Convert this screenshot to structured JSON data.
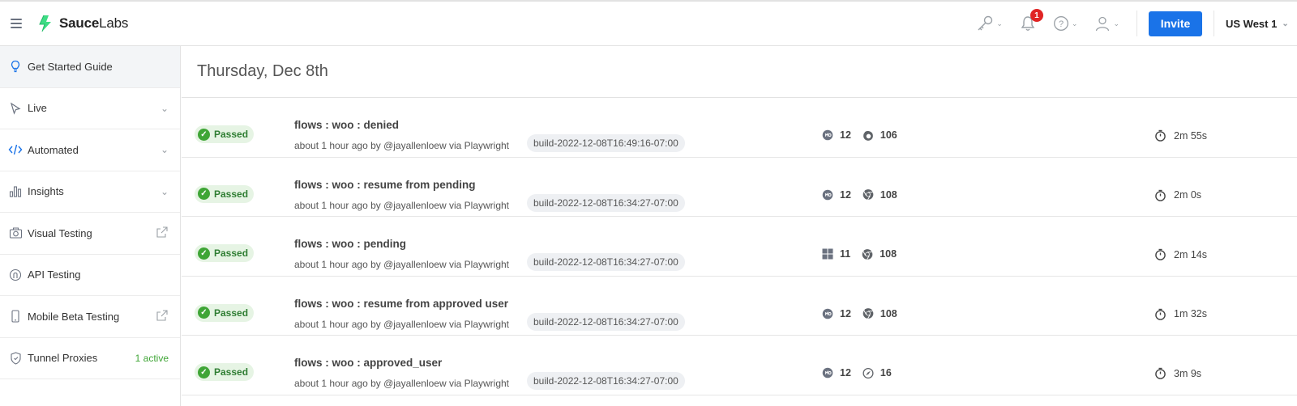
{
  "header": {
    "brand_bold": "Sauce",
    "brand_rest": "Labs",
    "notification_count": "1",
    "invite_label": "Invite",
    "region_label": "US West 1",
    "brand_color": "#3ddc84",
    "accent_color": "#1a73e8"
  },
  "sidebar": {
    "items": [
      {
        "label": "Get Started Guide",
        "icon": "lightbulb-icon",
        "right": ""
      },
      {
        "label": "Live",
        "icon": "cursor-icon",
        "right": "chevron-down"
      },
      {
        "label": "Automated",
        "icon": "code-icon",
        "right": "chevron-down"
      },
      {
        "label": "Insights",
        "icon": "bar-chart-icon",
        "right": "chevron-down"
      },
      {
        "label": "Visual Testing",
        "icon": "camera-icon",
        "right": "external-link"
      },
      {
        "label": "API Testing",
        "icon": "api-icon",
        "right": ""
      },
      {
        "label": "Mobile Beta Testing",
        "icon": "phone-icon",
        "right": "external-link"
      },
      {
        "label": "Tunnel Proxies",
        "icon": "shield-icon",
        "right": "1 active"
      }
    ]
  },
  "main": {
    "date_heading": "Thursday, Dec 8th",
    "rows": [
      {
        "status": "Passed",
        "title": "flows : woo : denied",
        "meta": "about 1 hour ago by @jayallenloew via Playwright",
        "build": "build-2022-12-08T16:49:16-07:00",
        "os_icon": "mac-icon",
        "os_version": "12",
        "browser_icon": "firefox-icon",
        "browser_version": "106",
        "duration": "2m 55s"
      },
      {
        "status": "Passed",
        "title": "flows : woo : resume from pending",
        "meta": "about 1 hour ago by @jayallenloew via Playwright",
        "build": "build-2022-12-08T16:34:27-07:00",
        "os_icon": "mac-icon",
        "os_version": "12",
        "browser_icon": "chrome-icon",
        "browser_version": "108",
        "duration": "2m 0s"
      },
      {
        "status": "Passed",
        "title": "flows : woo : pending",
        "meta": "about 1 hour ago by @jayallenloew via Playwright",
        "build": "build-2022-12-08T16:34:27-07:00",
        "os_icon": "windows-icon",
        "os_version": "11",
        "browser_icon": "chrome-icon",
        "browser_version": "108",
        "duration": "2m 14s"
      },
      {
        "status": "Passed",
        "title": "flows : woo : resume from approved user",
        "meta": "about 1 hour ago by @jayallenloew via Playwright",
        "build": "build-2022-12-08T16:34:27-07:00",
        "os_icon": "mac-icon",
        "os_version": "12",
        "browser_icon": "chrome-icon",
        "browser_version": "108",
        "duration": "1m 32s"
      },
      {
        "status": "Passed",
        "title": "flows : woo : approved_user",
        "meta": "about 1 hour ago by @jayallenloew via Playwright",
        "build": "build-2022-12-08T16:34:27-07:00",
        "os_icon": "mac-icon",
        "os_version": "12",
        "browser_icon": "safari-icon",
        "browser_version": "16",
        "duration": "3m 9s"
      }
    ]
  }
}
